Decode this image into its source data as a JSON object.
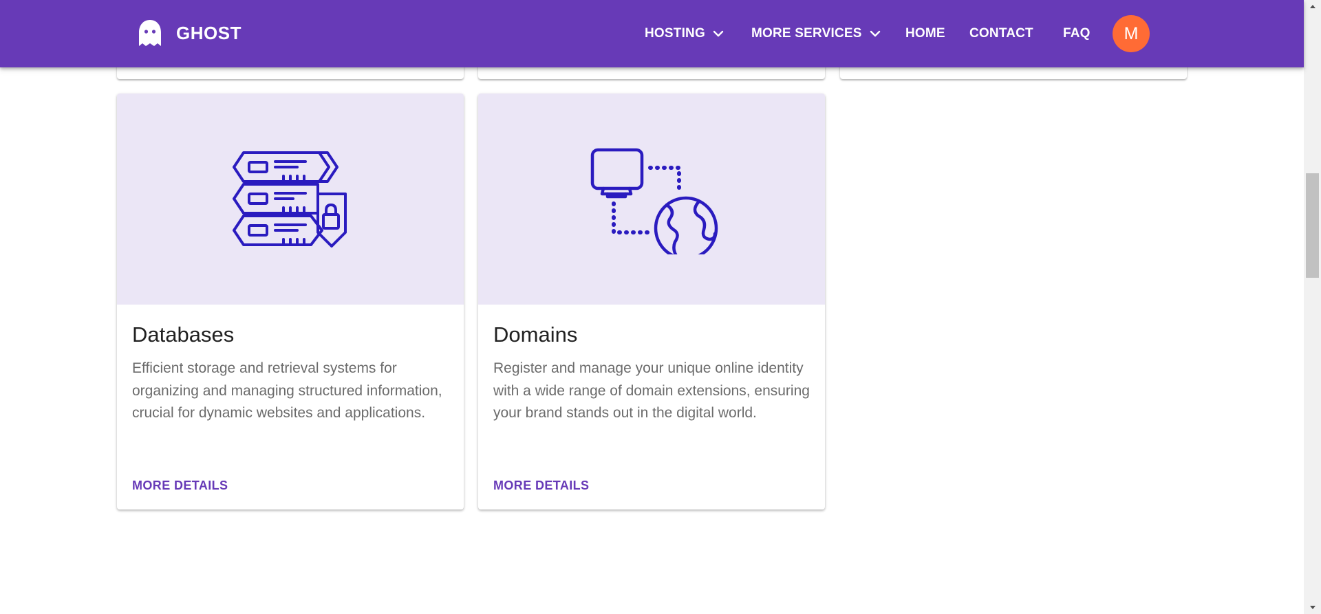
{
  "brand": {
    "name": "GHOST",
    "icon": "ghost-icon"
  },
  "nav": {
    "hosting": "HOSTING",
    "more_services": "MORE SERVICES",
    "home": "HOME",
    "contact": "CONTACT",
    "faq": "FAQ"
  },
  "user": {
    "avatar_initial": "M"
  },
  "cards": [
    {
      "title": "Databases",
      "description": "Efficient storage and retrieval systems for organizing and managing structured information, crucial for dynamic websites and applications.",
      "action": "MORE DETAILS",
      "icon": "database-server-lock-icon"
    },
    {
      "title": "Domains",
      "description": "Register and manage your unique online identity with a wide range of domain extensions, ensuring your brand stands out in the digital world.",
      "action": "MORE DETAILS",
      "icon": "computer-globe-icon"
    }
  ],
  "colors": {
    "primary": "#673ab7",
    "avatar": "#ff6b35",
    "media_bg": "#ebe6f6",
    "icon_stroke": "#2a1bbf"
  }
}
